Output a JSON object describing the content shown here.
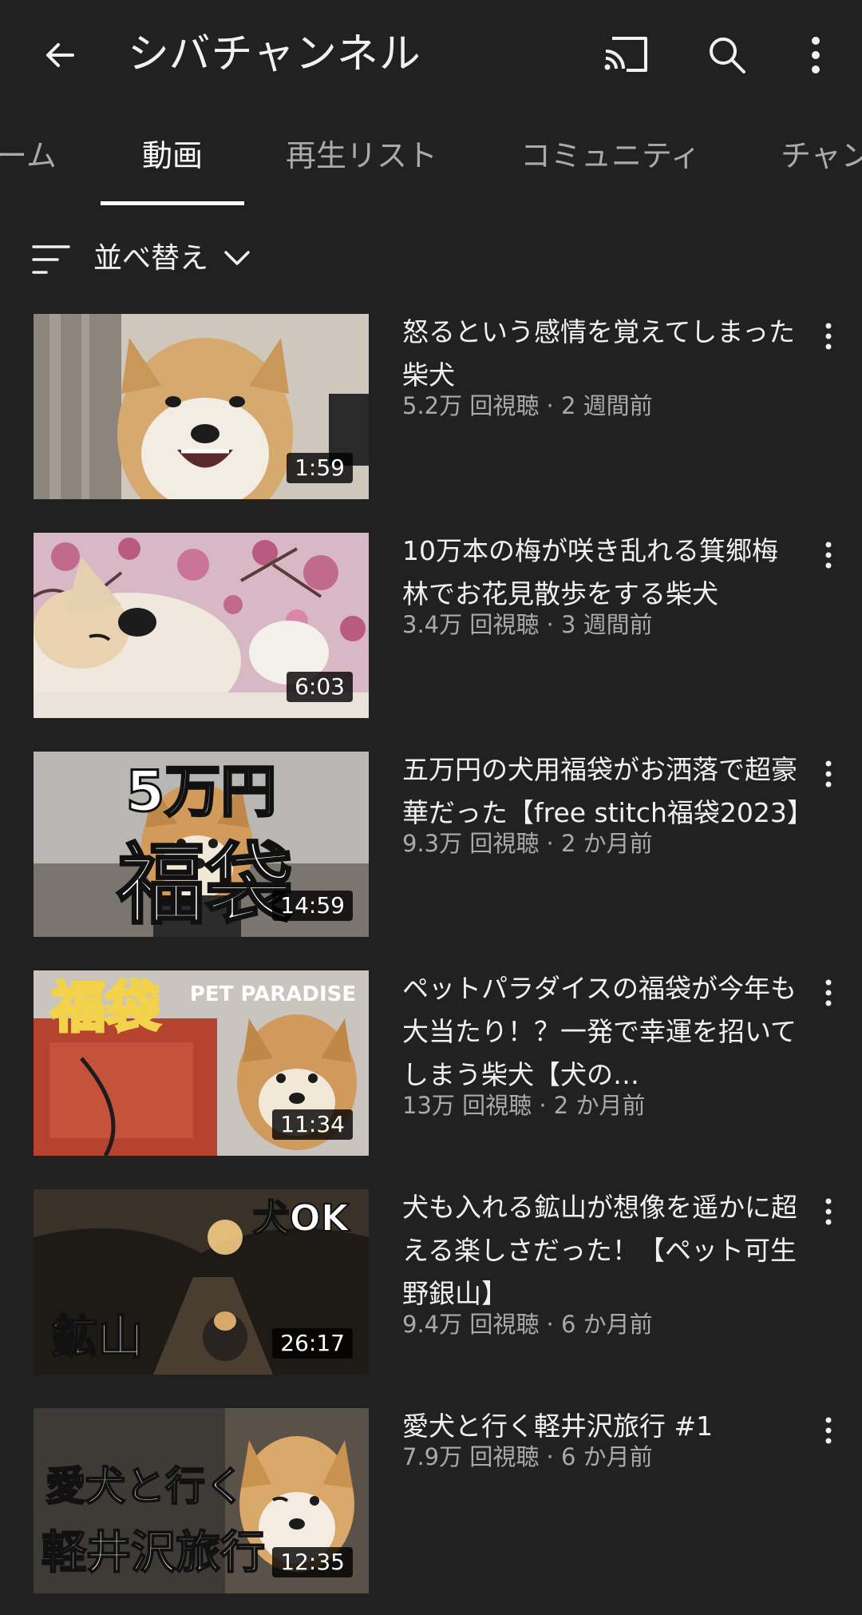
{
  "header": {
    "title": "シバチャンネル",
    "back_icon": "back-arrow-icon",
    "cast_icon": "cast-icon",
    "search_icon": "search-icon",
    "more_icon": "more-vert-icon"
  },
  "tabs": [
    {
      "label": "ーム",
      "active": false
    },
    {
      "label": "動画",
      "active": true
    },
    {
      "label": "再生リスト",
      "active": false
    },
    {
      "label": "コミュニティ",
      "active": false
    },
    {
      "label": "チャン",
      "active": false
    }
  ],
  "sort": {
    "label": "並べ替え",
    "icon": "sort-icon",
    "chevron_icon": "chevron-down-icon"
  },
  "videos": [
    {
      "title": "怒るという感情を覚えてしまった柴犬",
      "views": "5.2万 回視聴",
      "age": "2 週間前",
      "meta": "5.2万 回視聴 · 2 週間前",
      "duration": "1:59"
    },
    {
      "title": "10万本の梅が咲き乱れる箕郷梅林でお花見散歩をする柴犬",
      "views": "3.4万 回視聴",
      "age": "3 週間前",
      "meta": "3.4万 回視聴 · 3 週間前",
      "duration": "6:03"
    },
    {
      "title": "五万円の犬用福袋がお洒落で超豪華だった【free stitch福袋2023】",
      "views": "9.3万 回視聴",
      "age": "2 か月前",
      "meta": "9.3万 回視聴 · 2 か月前",
      "duration": "14:59",
      "thumb_text": [
        "5万円",
        "福袋"
      ]
    },
    {
      "title": "ペットパラダイスの福袋が今年も大当たり！？一発で幸運を招いてしまう柴犬【犬の…",
      "views": "13万 回視聴",
      "age": "2 か月前",
      "meta": "13万 回視聴 · 2 か月前",
      "duration": "11:34",
      "thumb_text": [
        "福袋",
        "PET PARADISE"
      ]
    },
    {
      "title": "犬も入れる鉱山が想像を遥かに超える楽しさだった！【ペット可生野銀山】",
      "views": "9.4万 回視聴",
      "age": "6 か月前",
      "meta": "9.4万 回視聴 · 6 か月前",
      "duration": "26:17",
      "thumb_text": [
        "犬OK",
        "鉱山"
      ]
    },
    {
      "title": "愛犬と行く軽井沢旅行 #1",
      "views": "7.9万 回視聴",
      "age": "6 か月前",
      "meta": "7.9万 回視聴 · 6 か月前",
      "duration": "12:35",
      "thumb_text": [
        "愛犬と行く",
        "軽井沢旅行"
      ]
    }
  ]
}
